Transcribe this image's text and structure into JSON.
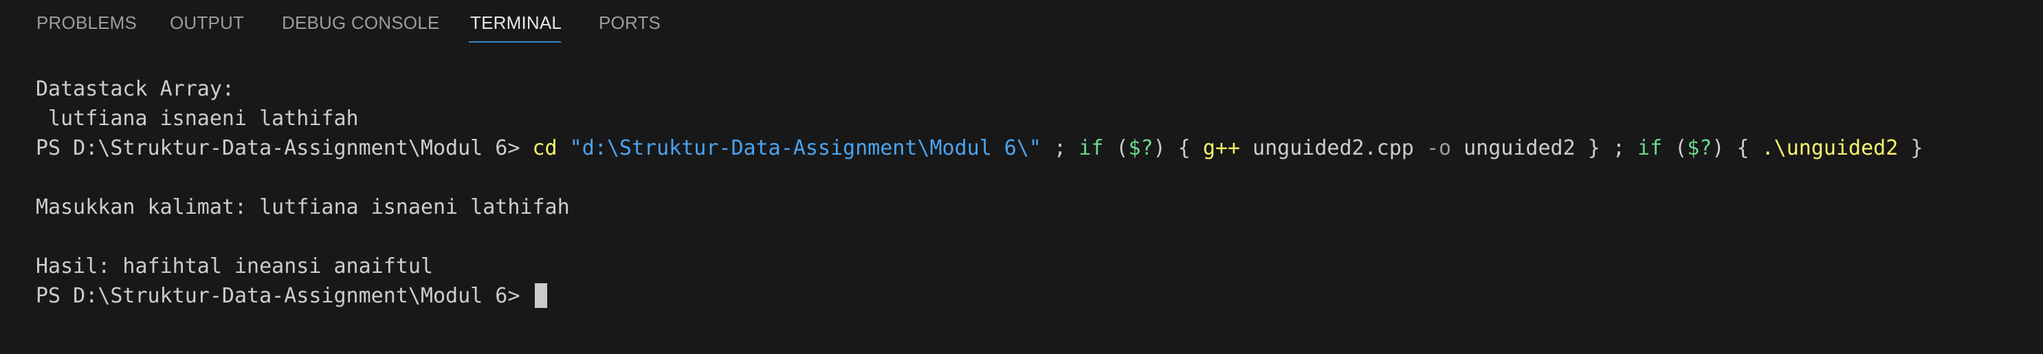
{
  "tabs": [
    {
      "label": "PROBLEMS"
    },
    {
      "label": "OUTPUT"
    },
    {
      "label": "DEBUG CONSOLE"
    },
    {
      "label": "TERMINAL"
    },
    {
      "label": "PORTS"
    }
  ],
  "colors": {
    "background": "#181818",
    "tab_inactive": "#9d9d9d",
    "tab_active": "#e7e7e7",
    "tab_underline": "#3b82c6",
    "text": "#cccccc",
    "command": "#f8f46b",
    "string": "#4aa3f0",
    "keyword": "#6ad88c"
  },
  "terminal": {
    "line1": "Datastack Array:",
    "line2": " lutfiana isnaeni lathifah",
    "cmd": {
      "prompt": "PS D:\\Struktur-Data-Assignment\\Modul 6> ",
      "cd": "cd",
      "path": "\"d:\\Struktur-Data-Assignment\\Modul 6\\\"",
      "sep1": " ; ",
      "if1": "if",
      "open1": " (",
      "var1": "$?",
      "close1": ") { ",
      "gpp": "g++",
      "args1": " unguided2.cpp ",
      "flag": "-o",
      "args2": " unguided2 } ; ",
      "if2": "if",
      "open2": " (",
      "var2": "$?",
      "close2": ") { ",
      "run": ".\\unguided2",
      "end": " }"
    },
    "line4": "",
    "line5": "Masukkan kalimat: lutfiana isnaeni lathifah",
    "line6": "",
    "line7": "Hasil: hafihtal ineansi anaiftul",
    "prompt_final": "PS D:\\Struktur-Data-Assignment\\Modul 6> "
  }
}
